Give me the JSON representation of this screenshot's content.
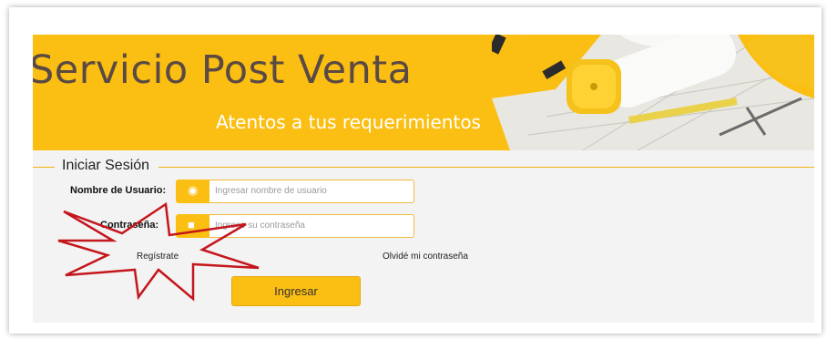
{
  "banner": {
    "title": "Servicio Post Venta",
    "subtitle": "Atentos a tus requerimientos"
  },
  "login": {
    "legend": "Iniciar Sesión",
    "username_label": "Nombre de Usuario:",
    "username_placeholder": "Ingresar nombre de usuario",
    "username_icon": "user-icon",
    "password_label": "Contraseña:",
    "password_placeholder": "Ingrese su contraseña",
    "password_icon": "lock-icon",
    "register_link": "Regístrate",
    "forgot_link": "Olvidé mi contraseña",
    "submit_label": "Ingresar"
  },
  "colors": {
    "accent": "#fbbe12",
    "title_text": "#5a4a43",
    "panel_bg": "#f3f3f3",
    "starburst": "#c4161c"
  }
}
